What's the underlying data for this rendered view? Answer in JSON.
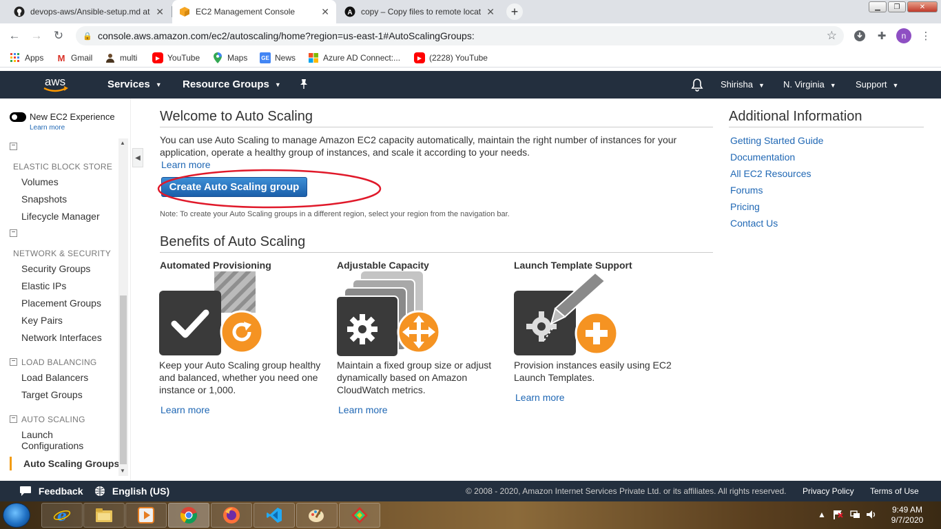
{
  "browser": {
    "tabs": [
      {
        "title": "devops-aws/Ansible-setup.md at",
        "icon": "github-icon"
      },
      {
        "title": "EC2 Management Console",
        "icon": "aws-cube-icon"
      },
      {
        "title": "copy – Copy files to remote locat",
        "icon": "ansible-icon"
      }
    ],
    "url": "console.aws.amazon.com/ec2/autoscaling/home?region=us-east-1#AutoScalingGroups:",
    "profile_initial": "n",
    "bookmarks": [
      {
        "label": "Apps",
        "icon": "apps-grid-icon"
      },
      {
        "label": "Gmail",
        "icon": "gmail-icon"
      },
      {
        "label": "multi",
        "icon": "person-icon"
      },
      {
        "label": "YouTube",
        "icon": "youtube-icon"
      },
      {
        "label": "Maps",
        "icon": "maps-icon"
      },
      {
        "label": "News",
        "icon": "news-icon"
      },
      {
        "label": "Azure AD Connect:...",
        "icon": "microsoft-icon"
      },
      {
        "label": "(2228) YouTube",
        "icon": "youtube-icon"
      }
    ]
  },
  "aws_nav": {
    "logo": "aws",
    "services": "Services",
    "resource_groups": "Resource Groups",
    "user": "Shirisha",
    "region": "N. Virginia",
    "support": "Support"
  },
  "sidebar": {
    "toggle_label": "New EC2 Experience",
    "learn_more": "Learn more",
    "sections": [
      {
        "title": "ELASTIC BLOCK STORE",
        "items": [
          "Volumes",
          "Snapshots",
          "Lifecycle Manager"
        ]
      },
      {
        "title": "NETWORK & SECURITY",
        "items": [
          "Security Groups",
          "Elastic IPs",
          "Placement Groups",
          "Key Pairs",
          "Network Interfaces"
        ]
      },
      {
        "title": "LOAD BALANCING",
        "items": [
          "Load Balancers",
          "Target Groups"
        ]
      },
      {
        "title": "AUTO SCALING",
        "items": [
          "Launch Configurations",
          "Auto Scaling Groups"
        ]
      }
    ],
    "launch_line1": "Launch",
    "launch_line2": "Configurations",
    "active_item": "Auto Scaling Groups"
  },
  "main": {
    "welcome_title": "Welcome to Auto Scaling",
    "welcome_text_1": "You can use Auto Scaling to manage Amazon EC2 capacity automatically, maintain the right number of instances for your",
    "welcome_text_2": "application, operate a healthy group of instances, and scale it according to your needs.",
    "learn_more": "Learn more",
    "create_button": "Create Auto Scaling group",
    "note": "Note: To create your Auto Scaling groups in a different region, select your region from the navigation bar.",
    "benefits_title": "Benefits of Auto Scaling",
    "benefits": [
      {
        "title": "Automated Provisioning",
        "line1": "Keep your Auto Scaling group healthy",
        "line2": "and balanced, whether you need one",
        "line3": "instance or 1,000.",
        "link": "Learn more",
        "icon": "automated-provisioning-icon"
      },
      {
        "title": "Adjustable Capacity",
        "line1": "Maintain a fixed group size or adjust",
        "line2": "dynamically based on Amazon",
        "line3": "CloudWatch metrics.",
        "link": "Learn more",
        "icon": "adjustable-capacity-icon"
      },
      {
        "title": "Launch Template Support",
        "line1": "Provision instances easily using EC2",
        "line2": "Launch Templates.",
        "line3": "",
        "link": "Learn more",
        "icon": "launch-template-icon"
      }
    ]
  },
  "additional": {
    "title": "Additional Information",
    "links": [
      "Getting Started Guide",
      "Documentation",
      "All EC2 Resources",
      "Forums",
      "Pricing",
      "Contact Us"
    ]
  },
  "footer": {
    "feedback": "Feedback",
    "language": "English (US)",
    "copyright": "© 2008 - 2020, Amazon Internet Services Private Ltd. or its affiliates. All rights reserved.",
    "privacy": "Privacy Policy",
    "terms": "Terms of Use"
  },
  "taskbar": {
    "time": "9:49 AM",
    "date": "9/7/2020"
  },
  "colors": {
    "aws_nav_bg": "#232f3e",
    "link": "#1f67b4",
    "orange": "#f39c12",
    "annotation": "#e0192a"
  }
}
